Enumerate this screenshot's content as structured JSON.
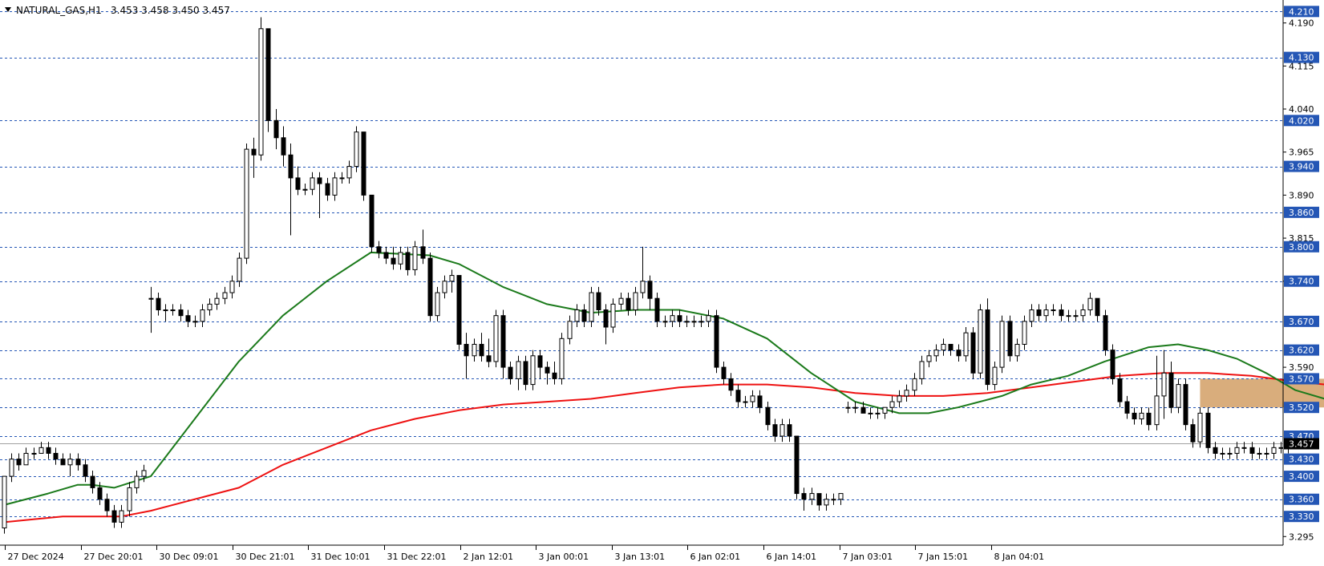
{
  "chart_data": {
    "type": "candlestick",
    "header": {
      "symbol_timeframe": "NATURAL_GAS,H1",
      "ohlc": "3.453 3.458 3.450 3.457"
    },
    "ylim": [
      3.28,
      4.23
    ],
    "x_tick_labels": [
      "27 Dec 2024",
      "27 Dec 20:01",
      "30 Dec 09:01",
      "30 Dec 21:01",
      "31 Dec 10:01",
      "31 Dec 22:01",
      "2 Jan 12:01",
      "3 Jan 00:01",
      "3 Jan 13:01",
      "6 Jan 02:01",
      "6 Jan 14:01",
      "7 Jan 03:01",
      "7 Jan 15:01",
      "8 Jan 04:01"
    ],
    "y_tick_labels": [
      {
        "value": 4.19,
        "label": "4.190"
      },
      {
        "value": 4.115,
        "label": "4.115"
      },
      {
        "value": 4.04,
        "label": "4.040"
      },
      {
        "value": 3.965,
        "label": "3.965"
      },
      {
        "value": 3.89,
        "label": "3.890"
      },
      {
        "value": 3.815,
        "label": "3.815"
      },
      {
        "value": 3.74,
        "label": "3.740"
      },
      {
        "value": 3.59,
        "label": "3.590"
      },
      {
        "value": 3.295,
        "label": "3.295"
      }
    ],
    "level_lines": [
      {
        "value": 4.21,
        "label": "4.210"
      },
      {
        "value": 4.13,
        "label": "4.130"
      },
      {
        "value": 4.02,
        "label": "4.020"
      },
      {
        "value": 3.94,
        "label": "3.940"
      },
      {
        "value": 3.86,
        "label": "3.860"
      },
      {
        "value": 3.8,
        "label": "3.800"
      },
      {
        "value": 3.74,
        "label": "3.740"
      },
      {
        "value": 3.67,
        "label": "3.670"
      },
      {
        "value": 3.62,
        "label": "3.620"
      },
      {
        "value": 3.57,
        "label": "3.570"
      },
      {
        "value": 3.52,
        "label": "3.520"
      },
      {
        "value": 3.47,
        "label": "3.470"
      },
      {
        "value": 3.43,
        "label": "3.430"
      },
      {
        "value": 3.4,
        "label": "3.400"
      },
      {
        "value": 3.36,
        "label": "3.360"
      },
      {
        "value": 3.33,
        "label": "3.330"
      }
    ],
    "current_price": {
      "value": 3.457,
      "label": "3.457"
    },
    "zone": {
      "bar_start": 163,
      "bar_end": 196,
      "low": 3.52,
      "high": 3.57
    },
    "candles": [
      [
        3.31,
        3.4,
        3.3,
        3.4
      ],
      [
        3.4,
        3.44,
        3.39,
        3.43
      ],
      [
        3.43,
        3.44,
        3.41,
        3.42
      ],
      [
        3.42,
        3.45,
        3.42,
        3.44
      ],
      [
        3.44,
        3.45,
        3.43,
        3.44
      ],
      [
        3.44,
        3.46,
        3.44,
        3.45
      ],
      [
        3.45,
        3.46,
        3.43,
        3.44
      ],
      [
        3.44,
        3.45,
        3.42,
        3.43
      ],
      [
        3.43,
        3.44,
        3.42,
        3.42
      ],
      [
        3.42,
        3.44,
        3.4,
        3.43
      ],
      [
        3.43,
        3.44,
        3.41,
        3.42
      ],
      [
        3.42,
        3.43,
        3.39,
        3.4
      ],
      [
        3.4,
        3.41,
        3.37,
        3.38
      ],
      [
        3.38,
        3.39,
        3.35,
        3.36
      ],
      [
        3.36,
        3.37,
        3.33,
        3.34
      ],
      [
        3.34,
        3.35,
        3.31,
        3.32
      ],
      [
        3.32,
        3.35,
        3.31,
        3.34
      ],
      [
        3.34,
        3.39,
        3.33,
        3.38
      ],
      [
        3.38,
        3.41,
        3.37,
        3.4
      ],
      [
        3.4,
        3.42,
        3.39,
        3.41
      ],
      [
        3.71,
        3.73,
        3.65,
        3.71
      ],
      [
        3.71,
        3.72,
        3.68,
        3.69
      ],
      [
        3.69,
        3.7,
        3.67,
        3.69
      ],
      [
        3.69,
        3.7,
        3.68,
        3.69
      ],
      [
        3.69,
        3.7,
        3.67,
        3.68
      ],
      [
        3.68,
        3.69,
        3.66,
        3.67
      ],
      [
        3.67,
        3.68,
        3.66,
        3.67
      ],
      [
        3.67,
        3.7,
        3.66,
        3.69
      ],
      [
        3.69,
        3.71,
        3.68,
        3.7
      ],
      [
        3.7,
        3.72,
        3.69,
        3.71
      ],
      [
        3.71,
        3.73,
        3.7,
        3.72
      ],
      [
        3.72,
        3.75,
        3.71,
        3.74
      ],
      [
        3.74,
        3.79,
        3.73,
        3.78
      ],
      [
        3.78,
        3.98,
        3.77,
        3.97
      ],
      [
        3.97,
        3.99,
        3.92,
        3.96
      ],
      [
        3.96,
        4.2,
        3.95,
        4.18
      ],
      [
        4.18,
        4.18,
        4.0,
        4.02
      ],
      [
        4.02,
        4.04,
        3.97,
        3.99
      ],
      [
        3.99,
        4.01,
        3.94,
        3.96
      ],
      [
        3.96,
        3.98,
        3.82,
        3.92
      ],
      [
        3.92,
        3.94,
        3.89,
        3.9
      ],
      [
        3.9,
        3.91,
        3.89,
        3.9
      ],
      [
        3.9,
        3.93,
        3.89,
        3.92
      ],
      [
        3.92,
        3.93,
        3.85,
        3.91
      ],
      [
        3.91,
        3.92,
        3.88,
        3.89
      ],
      [
        3.89,
        3.93,
        3.88,
        3.92
      ],
      [
        3.92,
        3.93,
        3.91,
        3.92
      ],
      [
        3.92,
        3.95,
        3.91,
        3.94
      ],
      [
        3.94,
        4.01,
        3.93,
        4.0
      ],
      [
        4.0,
        4.0,
        3.88,
        3.89
      ],
      [
        3.89,
        3.89,
        3.79,
        3.8
      ],
      [
        3.8,
        3.81,
        3.78,
        3.79
      ],
      [
        3.79,
        3.8,
        3.77,
        3.78
      ],
      [
        3.78,
        3.8,
        3.76,
        3.77
      ],
      [
        3.77,
        3.8,
        3.76,
        3.79
      ],
      [
        3.79,
        3.8,
        3.75,
        3.76
      ],
      [
        3.76,
        3.81,
        3.75,
        3.8
      ],
      [
        3.8,
        3.83,
        3.77,
        3.78
      ],
      [
        3.78,
        3.79,
        3.67,
        3.68
      ],
      [
        3.68,
        3.73,
        3.67,
        3.72
      ],
      [
        3.72,
        3.75,
        3.71,
        3.74
      ],
      [
        3.74,
        3.76,
        3.72,
        3.75
      ],
      [
        3.75,
        3.75,
        3.62,
        3.63
      ],
      [
        3.63,
        3.65,
        3.57,
        3.61
      ],
      [
        3.61,
        3.64,
        3.6,
        3.63
      ],
      [
        3.63,
        3.65,
        3.6,
        3.61
      ],
      [
        3.61,
        3.64,
        3.59,
        3.6
      ],
      [
        3.6,
        3.69,
        3.59,
        3.68
      ],
      [
        3.68,
        3.69,
        3.57,
        3.59
      ],
      [
        3.59,
        3.6,
        3.56,
        3.57
      ],
      [
        3.57,
        3.61,
        3.55,
        3.6
      ],
      [
        3.6,
        3.61,
        3.55,
        3.56
      ],
      [
        3.56,
        3.62,
        3.55,
        3.61
      ],
      [
        3.61,
        3.62,
        3.57,
        3.59
      ],
      [
        3.59,
        3.6,
        3.56,
        3.58
      ],
      [
        3.58,
        3.6,
        3.56,
        3.57
      ],
      [
        3.57,
        3.65,
        3.56,
        3.64
      ],
      [
        3.64,
        3.68,
        3.63,
        3.67
      ],
      [
        3.67,
        3.7,
        3.66,
        3.69
      ],
      [
        3.69,
        3.7,
        3.66,
        3.67
      ],
      [
        3.67,
        3.73,
        3.66,
        3.72
      ],
      [
        3.72,
        3.73,
        3.68,
        3.69
      ],
      [
        3.69,
        3.7,
        3.63,
        3.66
      ],
      [
        3.66,
        3.71,
        3.65,
        3.7
      ],
      [
        3.7,
        3.72,
        3.69,
        3.71
      ],
      [
        3.71,
        3.72,
        3.68,
        3.69
      ],
      [
        3.69,
        3.73,
        3.68,
        3.72
      ],
      [
        3.72,
        3.8,
        3.71,
        3.74
      ],
      [
        3.74,
        3.75,
        3.69,
        3.71
      ],
      [
        3.71,
        3.72,
        3.66,
        3.67
      ],
      [
        3.67,
        3.68,
        3.66,
        3.67
      ],
      [
        3.67,
        3.69,
        3.66,
        3.68
      ],
      [
        3.68,
        3.69,
        3.66,
        3.67
      ],
      [
        3.67,
        3.68,
        3.66,
        3.67
      ],
      [
        3.67,
        3.68,
        3.66,
        3.67
      ],
      [
        3.67,
        3.68,
        3.66,
        3.67
      ],
      [
        3.67,
        3.69,
        3.66,
        3.68
      ],
      [
        3.68,
        3.69,
        3.58,
        3.59
      ],
      [
        3.59,
        3.6,
        3.56,
        3.57
      ],
      [
        3.57,
        3.58,
        3.54,
        3.55
      ],
      [
        3.55,
        3.56,
        3.52,
        3.53
      ],
      [
        3.53,
        3.54,
        3.52,
        3.53
      ],
      [
        3.53,
        3.55,
        3.52,
        3.54
      ],
      [
        3.54,
        3.55,
        3.51,
        3.52
      ],
      [
        3.52,
        3.53,
        3.48,
        3.49
      ],
      [
        3.49,
        3.5,
        3.46,
        3.47
      ],
      [
        3.47,
        3.5,
        3.46,
        3.49
      ],
      [
        3.49,
        3.5,
        3.46,
        3.47
      ],
      [
        3.47,
        3.47,
        3.36,
        3.37
      ],
      [
        3.37,
        3.38,
        3.34,
        3.36
      ],
      [
        3.36,
        3.38,
        3.35,
        3.37
      ],
      [
        3.37,
        3.37,
        3.34,
        3.35
      ],
      [
        3.35,
        3.37,
        3.34,
        3.36
      ],
      [
        3.36,
        3.37,
        3.35,
        3.36
      ],
      [
        3.36,
        3.37,
        3.35,
        3.37
      ],
      [
        3.52,
        3.53,
        3.51,
        3.52
      ],
      [
        3.52,
        3.53,
        3.51,
        3.52
      ],
      [
        3.52,
        3.53,
        3.51,
        3.51
      ],
      [
        3.51,
        3.52,
        3.5,
        3.51
      ],
      [
        3.51,
        3.52,
        3.5,
        3.51
      ],
      [
        3.51,
        3.52,
        3.5,
        3.52
      ],
      [
        3.52,
        3.54,
        3.51,
        3.53
      ],
      [
        3.53,
        3.55,
        3.52,
        3.54
      ],
      [
        3.54,
        3.56,
        3.53,
        3.55
      ],
      [
        3.55,
        3.58,
        3.54,
        3.57
      ],
      [
        3.57,
        3.61,
        3.56,
        3.6
      ],
      [
        3.6,
        3.62,
        3.59,
        3.61
      ],
      [
        3.61,
        3.63,
        3.6,
        3.62
      ],
      [
        3.62,
        3.64,
        3.61,
        3.63
      ],
      [
        3.63,
        3.63,
        3.61,
        3.62
      ],
      [
        3.62,
        3.63,
        3.6,
        3.61
      ],
      [
        3.61,
        3.66,
        3.6,
        3.65
      ],
      [
        3.65,
        3.66,
        3.57,
        3.58
      ],
      [
        3.58,
        3.7,
        3.57,
        3.69
      ],
      [
        3.69,
        3.71,
        3.55,
        3.56
      ],
      [
        3.56,
        3.6,
        3.55,
        3.59
      ],
      [
        3.59,
        3.68,
        3.58,
        3.67
      ],
      [
        3.67,
        3.68,
        3.6,
        3.61
      ],
      [
        3.61,
        3.64,
        3.6,
        3.63
      ],
      [
        3.63,
        3.68,
        3.62,
        3.67
      ],
      [
        3.67,
        3.7,
        3.66,
        3.69
      ],
      [
        3.69,
        3.7,
        3.67,
        3.68
      ],
      [
        3.68,
        3.7,
        3.67,
        3.69
      ],
      [
        3.69,
        3.7,
        3.68,
        3.69
      ],
      [
        3.69,
        3.7,
        3.67,
        3.68
      ],
      [
        3.68,
        3.69,
        3.67,
        3.68
      ],
      [
        3.68,
        3.69,
        3.67,
        3.68
      ],
      [
        3.68,
        3.7,
        3.67,
        3.69
      ],
      [
        3.69,
        3.72,
        3.68,
        3.71
      ],
      [
        3.71,
        3.71,
        3.67,
        3.68
      ],
      [
        3.68,
        3.69,
        3.61,
        3.62
      ],
      [
        3.62,
        3.63,
        3.56,
        3.57
      ],
      [
        3.57,
        3.58,
        3.52,
        3.53
      ],
      [
        3.53,
        3.54,
        3.5,
        3.51
      ],
      [
        3.51,
        3.52,
        3.49,
        3.5
      ],
      [
        3.5,
        3.52,
        3.49,
        3.51
      ],
      [
        3.51,
        3.52,
        3.48,
        3.49
      ],
      [
        3.49,
        3.61,
        3.48,
        3.54
      ],
      [
        3.54,
        3.62,
        3.5,
        3.58
      ],
      [
        3.58,
        3.6,
        3.51,
        3.52
      ],
      [
        3.52,
        3.57,
        3.51,
        3.56
      ],
      [
        3.56,
        3.57,
        3.48,
        3.49
      ],
      [
        3.49,
        3.5,
        3.45,
        3.46
      ],
      [
        3.46,
        3.52,
        3.45,
        3.51
      ],
      [
        3.51,
        3.52,
        3.44,
        3.45
      ],
      [
        3.45,
        3.46,
        3.43,
        3.44
      ],
      [
        3.44,
        3.45,
        3.43,
        3.44
      ],
      [
        3.44,
        3.45,
        3.43,
        3.44
      ],
      [
        3.44,
        3.46,
        3.43,
        3.45
      ],
      [
        3.45,
        3.46,
        3.44,
        3.45
      ],
      [
        3.45,
        3.46,
        3.43,
        3.44
      ],
      [
        3.44,
        3.45,
        3.43,
        3.44
      ],
      [
        3.44,
        3.45,
        3.43,
        3.44
      ],
      [
        3.44,
        3.46,
        3.43,
        3.45
      ],
      [
        3.45,
        3.46,
        3.44,
        3.45
      ],
      [
        3.45,
        3.46,
        3.44,
        3.46
      ]
    ],
    "ma_fast": [
      [
        0,
        3.35
      ],
      [
        6,
        3.37
      ],
      [
        10,
        3.385
      ],
      [
        12,
        3.385
      ],
      [
        15,
        3.38
      ],
      [
        20,
        3.4
      ],
      [
        26,
        3.5
      ],
      [
        32,
        3.6
      ],
      [
        38,
        3.68
      ],
      [
        44,
        3.74
      ],
      [
        50,
        3.79
      ],
      [
        58,
        3.785
      ],
      [
        62,
        3.77
      ],
      [
        68,
        3.73
      ],
      [
        74,
        3.7
      ],
      [
        80,
        3.685
      ],
      [
        86,
        3.69
      ],
      [
        92,
        3.69
      ],
      [
        98,
        3.675
      ],
      [
        104,
        3.64
      ],
      [
        110,
        3.58
      ],
      [
        116,
        3.53
      ],
      [
        122,
        3.51
      ],
      [
        126,
        3.51
      ],
      [
        130,
        3.52
      ],
      [
        136,
        3.54
      ],
      [
        140,
        3.56
      ],
      [
        145,
        3.575
      ],
      [
        150,
        3.6
      ],
      [
        156,
        3.625
      ],
      [
        160,
        3.63
      ],
      [
        164,
        3.62
      ],
      [
        168,
        3.605
      ],
      [
        172,
        3.58
      ],
      [
        176,
        3.55
      ],
      [
        180,
        3.535
      ],
      [
        183,
        3.525
      ]
    ],
    "ma_slow": [
      [
        0,
        3.32
      ],
      [
        4,
        3.325
      ],
      [
        8,
        3.33
      ],
      [
        12,
        3.33
      ],
      [
        16,
        3.33
      ],
      [
        20,
        3.34
      ],
      [
        26,
        3.36
      ],
      [
        32,
        3.38
      ],
      [
        38,
        3.42
      ],
      [
        44,
        3.45
      ],
      [
        50,
        3.48
      ],
      [
        56,
        3.5
      ],
      [
        62,
        3.515
      ],
      [
        68,
        3.525
      ],
      [
        74,
        3.53
      ],
      [
        80,
        3.535
      ],
      [
        86,
        3.545
      ],
      [
        92,
        3.555
      ],
      [
        98,
        3.56
      ],
      [
        104,
        3.56
      ],
      [
        110,
        3.555
      ],
      [
        116,
        3.545
      ],
      [
        122,
        3.54
      ],
      [
        128,
        3.54
      ],
      [
        134,
        3.545
      ],
      [
        140,
        3.555
      ],
      [
        146,
        3.565
      ],
      [
        152,
        3.575
      ],
      [
        158,
        3.58
      ],
      [
        164,
        3.58
      ],
      [
        170,
        3.575
      ],
      [
        176,
        3.565
      ],
      [
        180,
        3.56
      ]
    ],
    "colors": {
      "candle": "#000000",
      "ma_fast": "#1b7a1b",
      "ma_slow": "#ee1111",
      "level": "#2456b5",
      "zone": "#d9ad7c",
      "current_line": "#a0a0a0",
      "current_badge": "#000000"
    }
  }
}
